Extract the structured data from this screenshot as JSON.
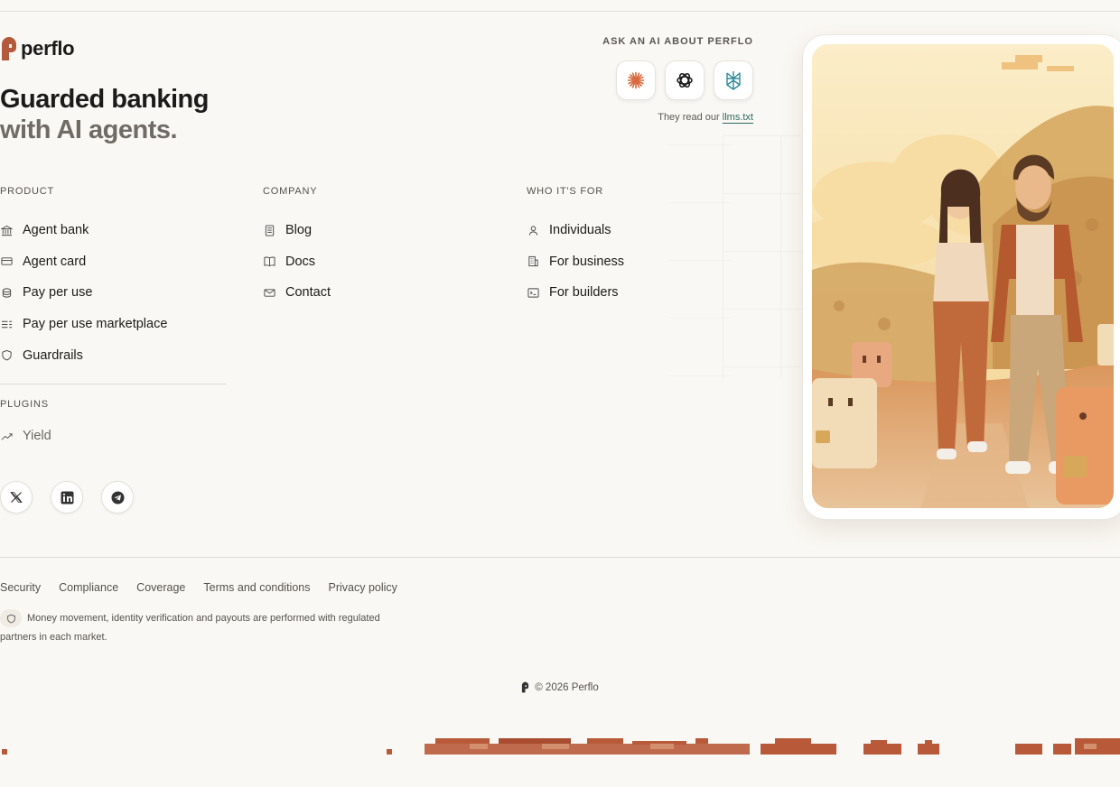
{
  "brand": {
    "name": "perflo",
    "accent": "#b45a3c"
  },
  "hero": {
    "line1": "Guarded banking",
    "line2": "with AI agents."
  },
  "ask_ai": {
    "title": "ASK AN AI ABOUT PERFLO",
    "buttons": [
      {
        "name": "claude",
        "icon": "sunburst-icon"
      },
      {
        "name": "chatgpt",
        "icon": "openai-icon"
      },
      {
        "name": "perplexity",
        "icon": "perplexity-icon"
      }
    ],
    "note_prefix": "They read our",
    "note_link": "llms.txt"
  },
  "columns": {
    "product": {
      "title": "PRODUCT",
      "items": [
        {
          "label": "Agent bank",
          "icon": "bank-icon"
        },
        {
          "label": "Agent card",
          "icon": "card-icon"
        },
        {
          "label": "Pay per use",
          "icon": "coins-icon"
        },
        {
          "label": "Pay per use marketplace",
          "icon": "list-icon"
        },
        {
          "label": "Guardrails",
          "icon": "shield-icon"
        }
      ]
    },
    "company": {
      "title": "COMPANY",
      "items": [
        {
          "label": "Blog",
          "icon": "document-icon"
        },
        {
          "label": "Docs",
          "icon": "book-icon"
        },
        {
          "label": "Contact",
          "icon": "mail-icon"
        }
      ]
    },
    "audience": {
      "title": "WHO IT'S FOR",
      "items": [
        {
          "label": "Individuals",
          "icon": "person-icon"
        },
        {
          "label": "For business",
          "icon": "building-icon"
        },
        {
          "label": "For builders",
          "icon": "terminal-icon"
        }
      ]
    }
  },
  "plugins": {
    "title": "PLUGINS",
    "items": [
      {
        "label": "Yield",
        "icon": "trend-up-icon"
      }
    ]
  },
  "socials": [
    {
      "name": "x",
      "icon": "x-icon"
    },
    {
      "name": "linkedin",
      "icon": "linkedin-icon"
    },
    {
      "name": "telegram",
      "icon": "telegram-icon"
    }
  ],
  "footer": {
    "links": [
      "Security",
      "Compliance",
      "Coverage",
      "Terms and conditions",
      "Privacy policy"
    ],
    "notice": "Money movement, identity verification and payouts are performed with regulated partners in each market.",
    "copyright": "© 2026 Perflo"
  }
}
